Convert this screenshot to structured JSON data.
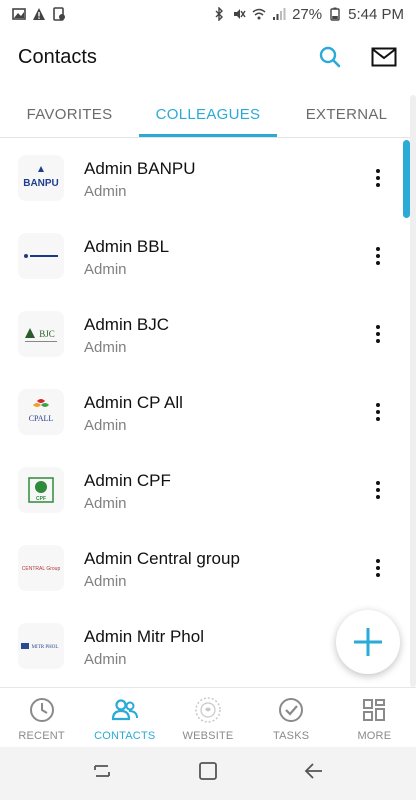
{
  "status_bar": {
    "battery": "27%",
    "time": "5:44 PM"
  },
  "app_bar": {
    "title": "Contacts"
  },
  "tabs": [
    {
      "label": "FAVORITES",
      "active": false
    },
    {
      "label": "COLLEAGUES",
      "active": true
    },
    {
      "label": "EXTERNAL",
      "active": false
    }
  ],
  "contacts": [
    {
      "name": "Admin BANPU",
      "role": "Admin",
      "logo_text": "BANPU",
      "logo_color": "#1e3f8e"
    },
    {
      "name": "Admin BBL",
      "role": "Admin",
      "logo_text": "",
      "logo_color": "#1c3a8c"
    },
    {
      "name": "Admin BJC",
      "role": "Admin",
      "logo_text": "BJC",
      "logo_color": "#2b5d2a"
    },
    {
      "name": "Admin CP All",
      "role": "Admin",
      "logo_text": "CPALL",
      "logo_color": "#2a3f8f"
    },
    {
      "name": "Admin CPF",
      "role": "Admin",
      "logo_text": "CPF",
      "logo_color": "#2f8a3a"
    },
    {
      "name": "Admin Central group",
      "role": "Admin",
      "logo_text": "CENTRAL Group",
      "logo_color": "#b23a3a"
    },
    {
      "name": "Admin Mitr Phol",
      "role": "Admin",
      "logo_text": "MITR PHOL",
      "logo_color": "#2a4b8d"
    }
  ],
  "bottom_nav": [
    {
      "label": "RECENT",
      "icon": "clock-icon",
      "active": false
    },
    {
      "label": "CONTACTS",
      "icon": "people-icon",
      "active": true
    },
    {
      "label": "WEBSITE",
      "icon": "website-icon",
      "active": false
    },
    {
      "label": "TASKS",
      "icon": "check-circle-icon",
      "active": false
    },
    {
      "label": "MORE",
      "icon": "grid-icon",
      "active": false
    }
  ],
  "colors": {
    "accent": "#2aaad6",
    "text": "#111111",
    "secondary_text": "#808080"
  }
}
